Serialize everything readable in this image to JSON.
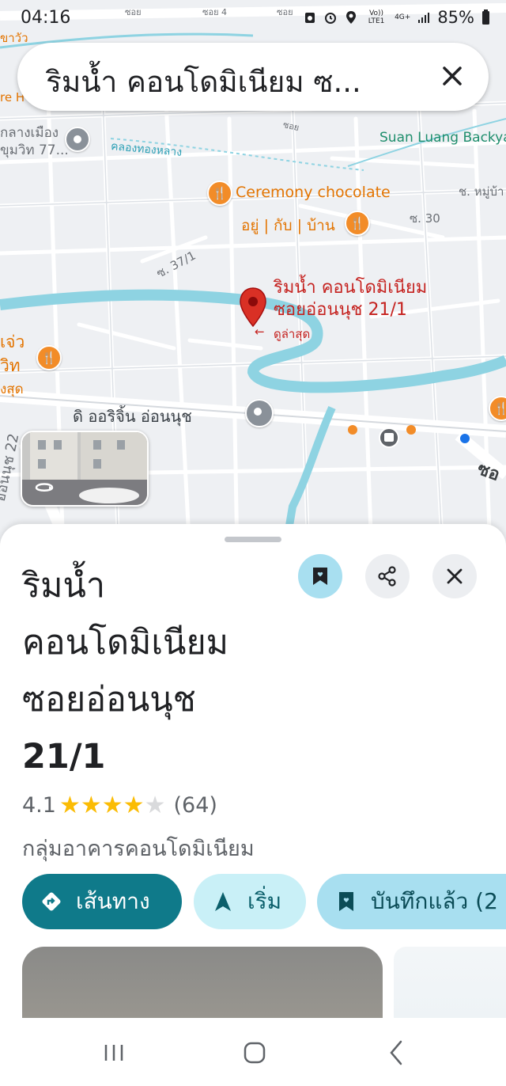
{
  "status_bar": {
    "time": "04:16",
    "network": "Vo)) LTE1",
    "data": "4G+",
    "battery": "85%"
  },
  "search": {
    "query": "ริมน้ำ คอนโดมิเนียม ซ..."
  },
  "map": {
    "labels": {
      "top_soi": "ซอย",
      "top_soi4": "ซอย 4",
      "top_soi_right": "ซอย",
      "left_clip1": "ขาวัว",
      "left_clip2": "re H",
      "klang_muang": "กลางเมือง",
      "sukhumvit": "ขุมวิท 77...",
      "khlong": "คลองทองหลาง",
      "soi_mid": "ซอย",
      "suan_luang": "Suan Luang Backya",
      "ceremony": "Ceremony chocolate",
      "moo_ban": "ช. หมู่บ้า",
      "yu_kab_baan": "อยู่ | กับ | บ้าน",
      "soi30": "ซ. 30",
      "soi37": "ซ. 37/1",
      "pin_title_1": "ริมน้ำ คอนโดมิเนียม",
      "pin_title_2": "ซอยอ่อนนุช 21/1",
      "pin_sub": "ดูล่าสุด",
      "left_jao": "เจ่ว",
      "left_wit": "วิท",
      "left_sud": "งสุด",
      "origin": "ดิ ออริจิ้น อ่อนนุช",
      "onnut_vertical": "อ่อนนุช 22",
      "right_soi": "ซอ"
    }
  },
  "place": {
    "title_lines": [
      "ริมน้ำ",
      "คอนโดมิเนียม",
      "ซอยอ่อนนุช",
      "21/1"
    ],
    "rating": "4.1",
    "rating_value": 4.1,
    "reviews": "(64)",
    "category": "กลุ่มอาคารคอนโดมิเนียม"
  },
  "actions": {
    "directions": "เส้นทาง",
    "start": "เริ่ม",
    "saved": "บันทึกแล้ว (2"
  },
  "icons": {
    "save": "bookmark-heart-icon",
    "share": "share-icon",
    "close": "close-icon"
  },
  "colors": {
    "accent": "#0f7a8a",
    "water": "#8ed3e2",
    "pin": "#d93025",
    "food": "#f28c28",
    "star": "#fbbc04"
  }
}
